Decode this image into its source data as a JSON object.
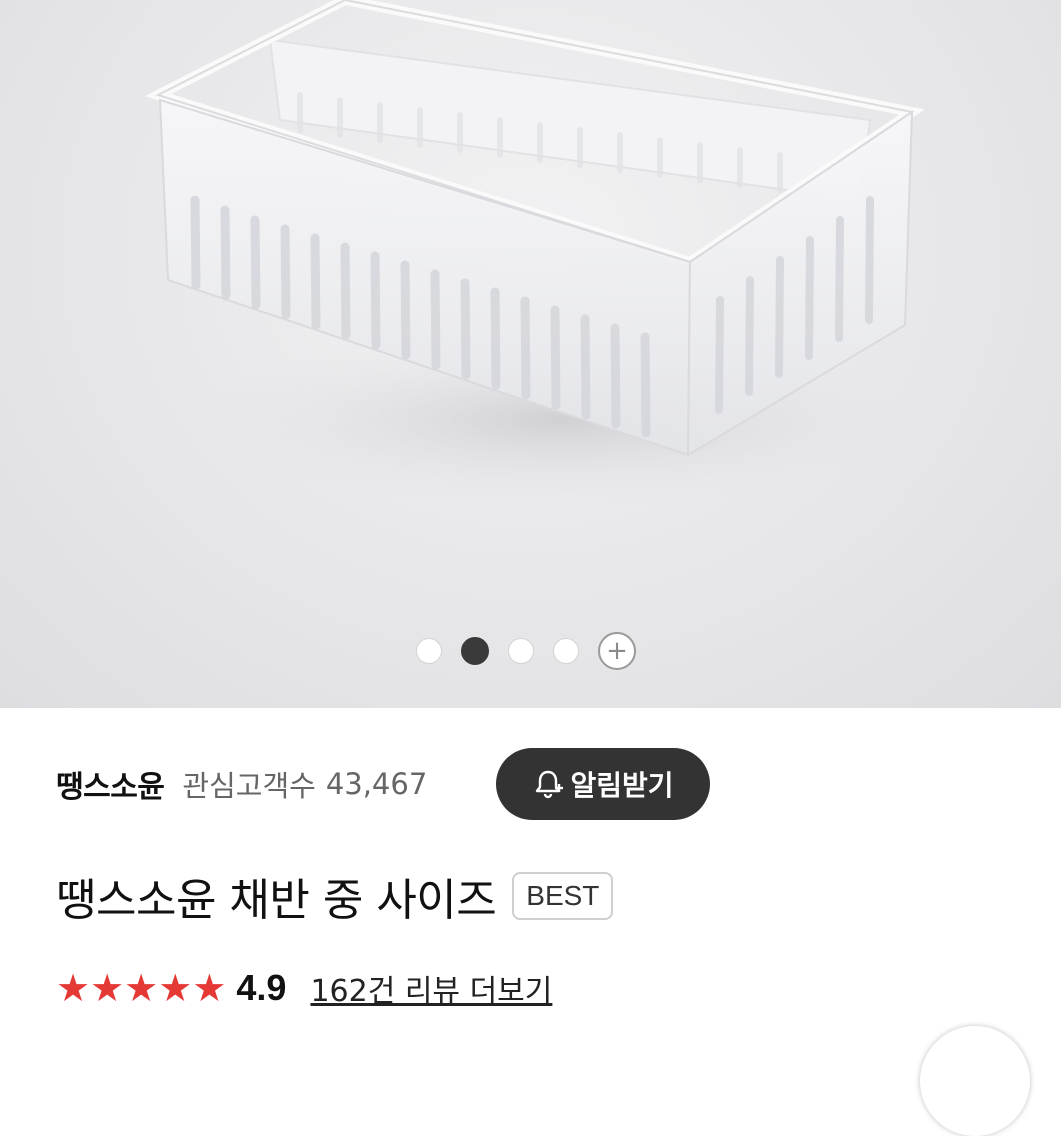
{
  "gallery": {
    "image_alt": "clear plastic draining basket",
    "slide_count": 4,
    "active_index": 1,
    "more_icon": "plus-circle-icon"
  },
  "store": {
    "name": "땡스소윤",
    "fans_label": "관심고객수",
    "fans_count": "43,467",
    "alarm_button": "알림받기",
    "alarm_icon": "bell-plus-icon"
  },
  "product": {
    "title": "땡스소윤 채반 중 사이즈",
    "badge": "BEST",
    "rating": "4.9",
    "stars": 5,
    "star_color": "#e53935",
    "review_link": "162건 리뷰 더보기"
  },
  "colors": {
    "button_bg": "#333333",
    "active_dot": "#3a3a3a"
  }
}
